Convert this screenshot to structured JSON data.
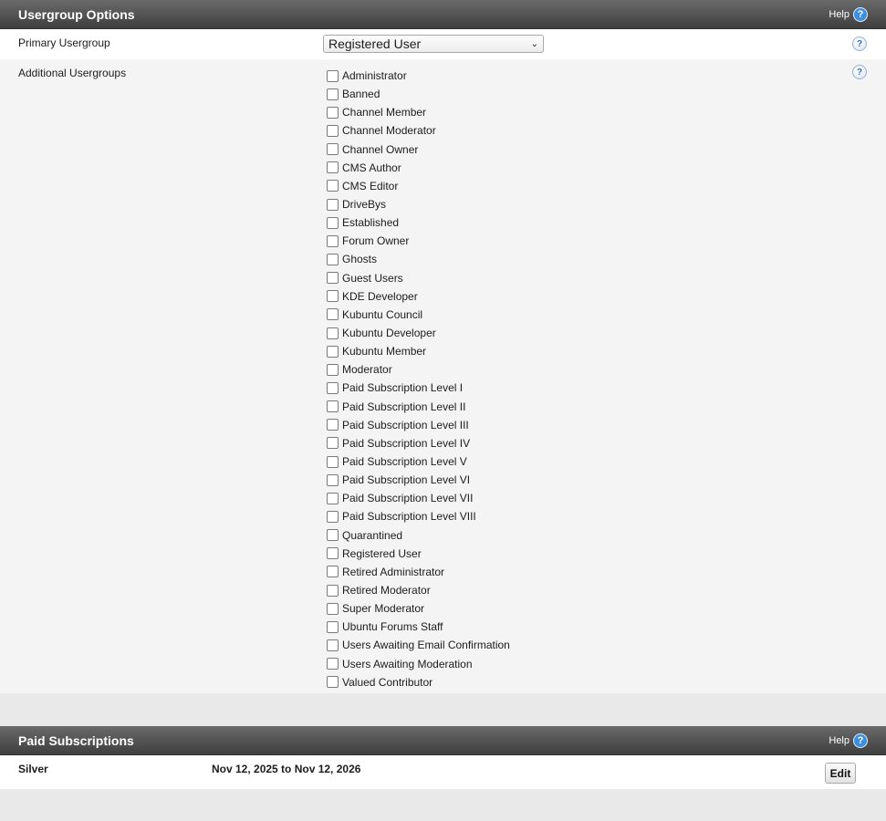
{
  "usergroup_options": {
    "title": "Usergroup Options",
    "help_label": "Help",
    "primary": {
      "label": "Primary Usergroup",
      "selected": "Registered User"
    },
    "additional": {
      "label": "Additional Usergroups",
      "groups": [
        "Administrator",
        "Banned",
        "Channel Member",
        "Channel Moderator",
        "Channel Owner",
        "CMS Author",
        "CMS Editor",
        "DriveBys",
        "Established",
        "Forum Owner",
        "Ghosts",
        "Guest Users",
        "KDE Developer",
        "Kubuntu Council",
        "Kubuntu Developer",
        "Kubuntu Member",
        "Moderator",
        "Paid Subscription Level I",
        "Paid Subscription Level II",
        "Paid Subscription Level III",
        "Paid Subscription Level IV",
        "Paid Subscription Level V",
        "Paid Subscription Level VI",
        "Paid Subscription Level VII",
        "Paid Subscription Level VIII",
        "Quarantined",
        "Registered User",
        "Retired Administrator",
        "Retired Moderator",
        "Super Moderator",
        "Ubuntu Forums Staff",
        "Users Awaiting Email Confirmation",
        "Users Awaiting Moderation",
        "Valued Contributor"
      ]
    }
  },
  "paid_subscriptions": {
    "title": "Paid Subscriptions",
    "help_label": "Help",
    "subscription": {
      "name": "Silver",
      "dates": "Nov 12, 2025 to Nov 12, 2026",
      "edit_label": "Edit"
    }
  },
  "icons": {
    "help": "help-question-icon",
    "row_help": "question-mark-icon",
    "dropdown": "chevron-down-icon"
  },
  "colors": {
    "header_gradient_top": "#6a6a6a",
    "header_gradient_bottom": "#3f3f3f",
    "help_icon": "#3d8fe0",
    "page_background": "#e9e9e9"
  }
}
